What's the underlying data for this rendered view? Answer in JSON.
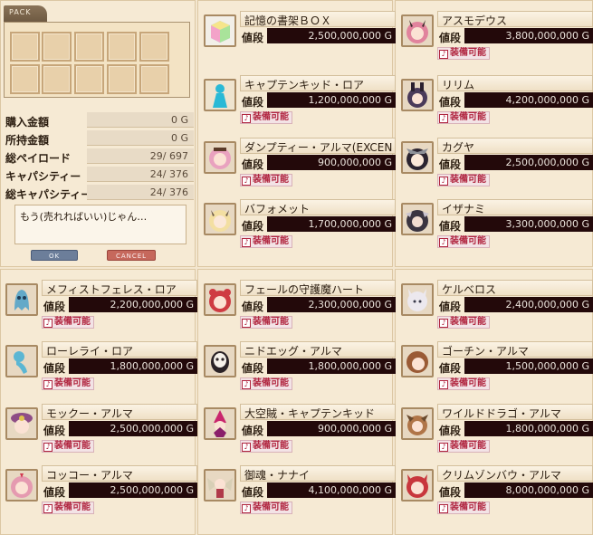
{
  "pack": {
    "tab_label": "PACK",
    "slot_count": 10,
    "stats": [
      {
        "label": "購入金額",
        "value": "0 G"
      },
      {
        "label": "所持金額",
        "value": "0 G"
      },
      {
        "label": "総ペイロード",
        "value": "29/ 697"
      },
      {
        "label": "キャパシティー",
        "value": "24/ 376"
      },
      {
        "label": "総キャパシティー",
        "value": "24/ 376"
      }
    ],
    "message": "もう(売れればいい)じゃん…",
    "ok_label": "OK",
    "cancel_label": "CANCEL"
  },
  "price_label": "値段",
  "equip_label": "装備可能",
  "items": [
    {
      "name": "記憶の書架ＢＯＸ",
      "price": "2,500,000,000 G",
      "equip": false,
      "icon": "rainbow-box-icon"
    },
    {
      "name": "キャプテンキッド・ロア",
      "price": "1,200,000,000 G",
      "equip": true,
      "icon": "cyan-silhouette-icon"
    },
    {
      "name": "ダンプティー・アルマ(EXCEN",
      "price": "900,000,000 G",
      "equip": true,
      "icon": "pink-hair-girl-icon"
    },
    {
      "name": "バフォメット",
      "price": "1,700,000,000 G",
      "equip": true,
      "icon": "blonde-horned-girl-icon"
    },
    {
      "name": "アスモデウス",
      "price": "3,800,000,000 G",
      "equip": true,
      "icon": "pink-demon-girl-icon"
    },
    {
      "name": "リリム",
      "price": "4,200,000,000 G",
      "equip": true,
      "icon": "dark-bunny-girl-icon"
    },
    {
      "name": "カグヤ",
      "price": "2,500,000,000 G",
      "equip": true,
      "icon": "black-hair-girl-icon"
    },
    {
      "name": "イザナミ",
      "price": "3,300,000,000 G",
      "equip": true,
      "icon": "dark-horned-girl-icon"
    },
    {
      "name": "メフィストフェレス・ロア",
      "price": "2,200,000,000 G",
      "equip": true,
      "icon": "blue-ghost-icon"
    },
    {
      "name": "ローレライ・ロア",
      "price": "1,800,000,000 G",
      "equip": true,
      "icon": "blue-mermaid-icon"
    },
    {
      "name": "モックー・アルマ",
      "price": "2,500,000,000 G",
      "equip": true,
      "icon": "purple-hat-girl-icon"
    },
    {
      "name": "コッコー・アルマ",
      "price": "2,500,000,000 G",
      "equip": true,
      "icon": "pink-chicken-girl-icon"
    },
    {
      "name": "フェールの守護魔ハート",
      "price": "2,300,000,000 G",
      "equip": true,
      "icon": "red-hair-girl-icon"
    },
    {
      "name": "ニドエッグ・アルマ",
      "price": "1,800,000,000 G",
      "equip": true,
      "icon": "egg-mask-icon"
    },
    {
      "name": "大空賊・キャプテンキッド",
      "price": "900,000,000 G",
      "equip": true,
      "icon": "red-witch-icon"
    },
    {
      "name": "御魂・ナナイ",
      "price": "4,100,000,000 G",
      "equip": true,
      "icon": "winged-girl-icon"
    },
    {
      "name": "ケルベロス",
      "price": "2,400,000,000 G",
      "equip": true,
      "icon": "white-wolf-girl-icon"
    },
    {
      "name": "ゴーチン・アルマ",
      "price": "1,500,000,000 G",
      "equip": true,
      "icon": "brown-hair-boy-icon"
    },
    {
      "name": "ワイルドドラゴ・アルマ",
      "price": "1,800,000,000 G",
      "equip": true,
      "icon": "brown-dragon-girl-icon"
    },
    {
      "name": "クリムゾンバウ・アルマ",
      "price": "8,000,000,000 G",
      "equip": true,
      "icon": "crimson-dog-girl-icon"
    }
  ],
  "colors": {
    "background": "#f3e6cf",
    "price_box": "#23090a",
    "equip_text": "#b0243e"
  }
}
